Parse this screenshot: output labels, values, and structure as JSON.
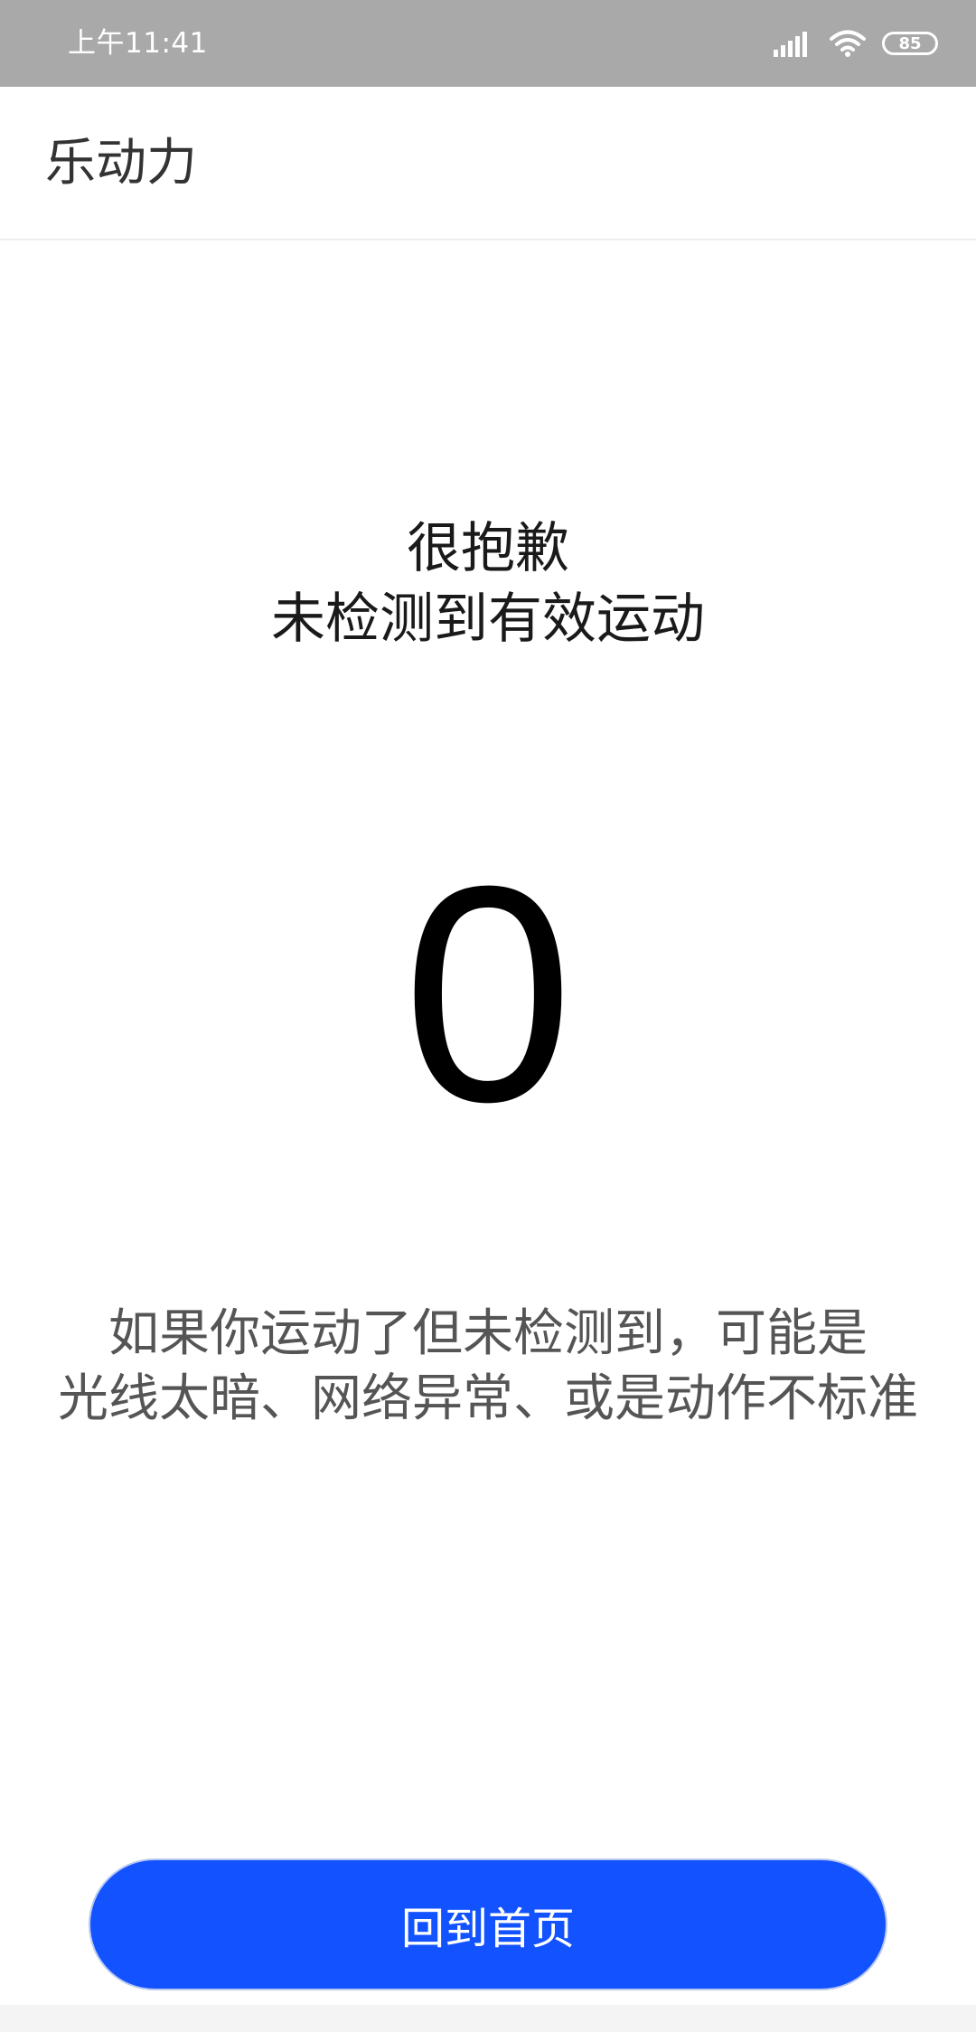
{
  "status_bar": {
    "time": "上午11:41",
    "battery": "85",
    "icons": [
      "signal-icon",
      "wifi-icon",
      "battery-icon"
    ]
  },
  "app_bar": {
    "title": "乐动力"
  },
  "result": {
    "headline_line1": "很抱歉",
    "headline_line2": "未检测到有效运动",
    "score": "0",
    "hint_line1": "如果你运动了但未检测到，可能是",
    "hint_line2": "光线太暗、网络异常、或是动作不标准"
  },
  "actions": {
    "home_label": "回到首页"
  },
  "colors": {
    "accent": "#1252ff",
    "status_bar": "#a9a9a9"
  }
}
